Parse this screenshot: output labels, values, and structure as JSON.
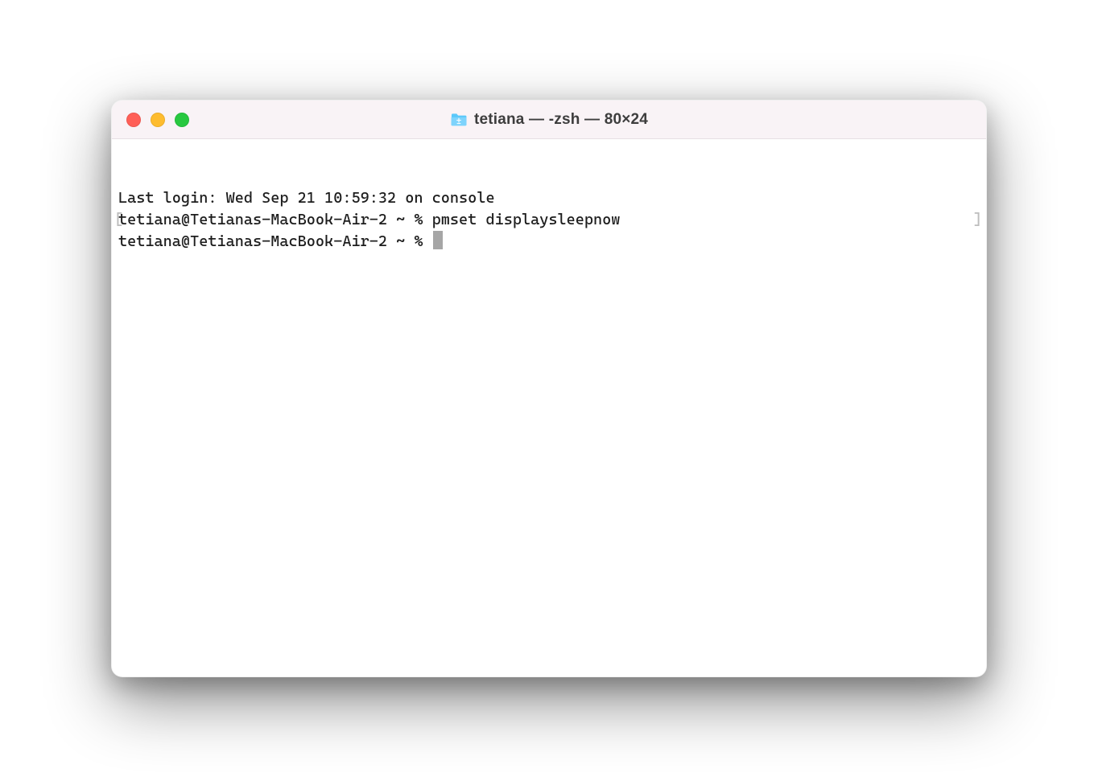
{
  "window": {
    "title": "tetiana — -zsh — 80×24"
  },
  "terminal": {
    "last_login": "Last login: Wed Sep 21 10:59:32 on console",
    "prompt1_full": "tetiana@Tetianas-MacBook-Air-2 ~ % pmset displaysleepnow",
    "prompt2_full": "tetiana@Tetianas-MacBook-Air-2 ~ % ",
    "bracket_left": "[",
    "bracket_right": "]"
  }
}
